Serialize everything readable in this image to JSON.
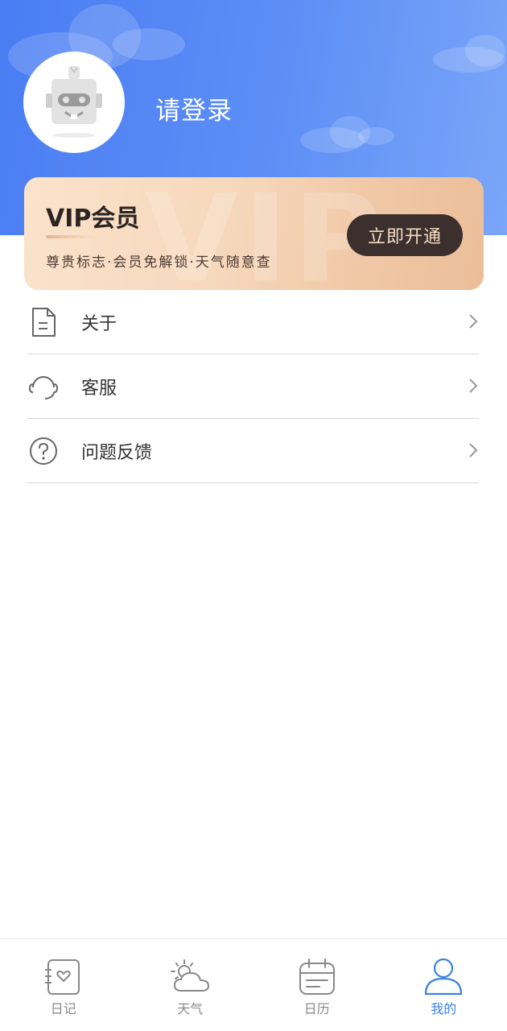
{
  "profile": {
    "login_text": "请登录"
  },
  "vip": {
    "title": "VIP会员",
    "description": "尊贵标志·会员免解锁·天气随意查",
    "button_label": "立即开通",
    "watermark": "VIP"
  },
  "menu": {
    "items": [
      {
        "label": "关于",
        "icon": "document-icon"
      },
      {
        "label": "客服",
        "icon": "headset-icon"
      },
      {
        "label": "问题反馈",
        "icon": "question-circle-icon"
      }
    ]
  },
  "tabbar": {
    "items": [
      {
        "label": "日记",
        "icon": "diary-icon",
        "active": false
      },
      {
        "label": "天气",
        "icon": "weather-icon",
        "active": false
      },
      {
        "label": "日历",
        "icon": "calendar-icon",
        "active": false
      },
      {
        "label": "我的",
        "icon": "user-icon",
        "active": true
      }
    ]
  },
  "colors": {
    "header_blue": "#4a7df3",
    "vip_gold": "#f0c7a5",
    "vip_button": "#3b302d",
    "active_tab": "#3d82e0",
    "inactive_tab": "#8a8a8a"
  }
}
